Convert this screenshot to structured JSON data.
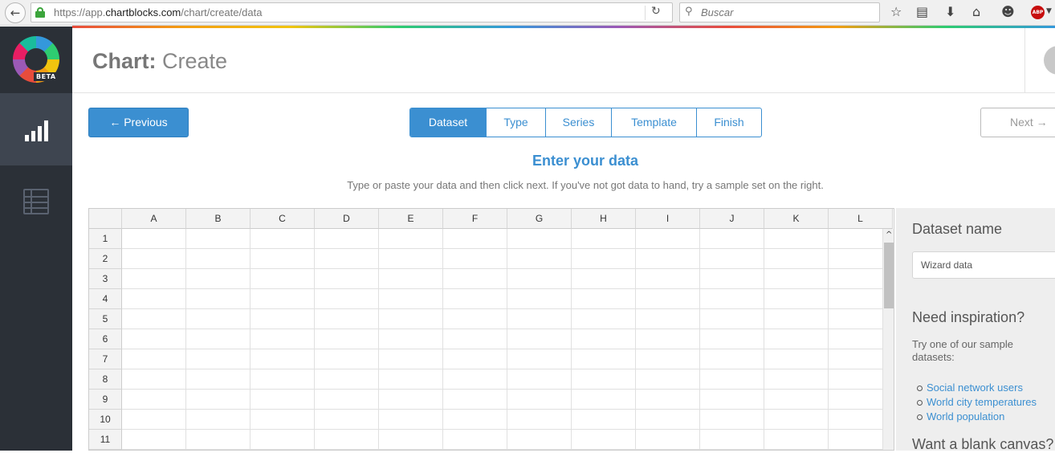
{
  "browser": {
    "url_prefix": "https://app.",
    "url_domain": "chartblocks.com",
    "url_path": "/chart/create/data",
    "search_placeholder": "Buscar",
    "abp_label": "ABP"
  },
  "sidebar": {
    "beta_label": "BETA"
  },
  "header": {
    "title_bold": "Chart:",
    "title_rest": " Create"
  },
  "wizard": {
    "previous_label": "← Previous",
    "next_label": "Next →",
    "steps": [
      "Dataset",
      "Type",
      "Series",
      "Template",
      "Finish"
    ],
    "active_step": "Dataset",
    "headline": "Enter your data",
    "subline": "Type or paste your data and then click next. If you've not got data to hand, try a sample set on the right."
  },
  "grid": {
    "columns": [
      "A",
      "B",
      "C",
      "D",
      "E",
      "F",
      "G",
      "H",
      "I",
      "J",
      "K",
      "L"
    ],
    "rows": [
      "1",
      "2",
      "3",
      "4",
      "5",
      "6",
      "7",
      "8",
      "9",
      "10",
      "11"
    ]
  },
  "panel": {
    "dataset_name_heading": "Dataset name",
    "dataset_name_value": "Wizard data",
    "inspiration_heading": "Need inspiration?",
    "inspiration_text": "Try one of our sample datasets:",
    "samples": [
      "Social network users",
      "World city temperatures",
      "World population"
    ],
    "blank_heading": "Want a blank canvas?"
  }
}
